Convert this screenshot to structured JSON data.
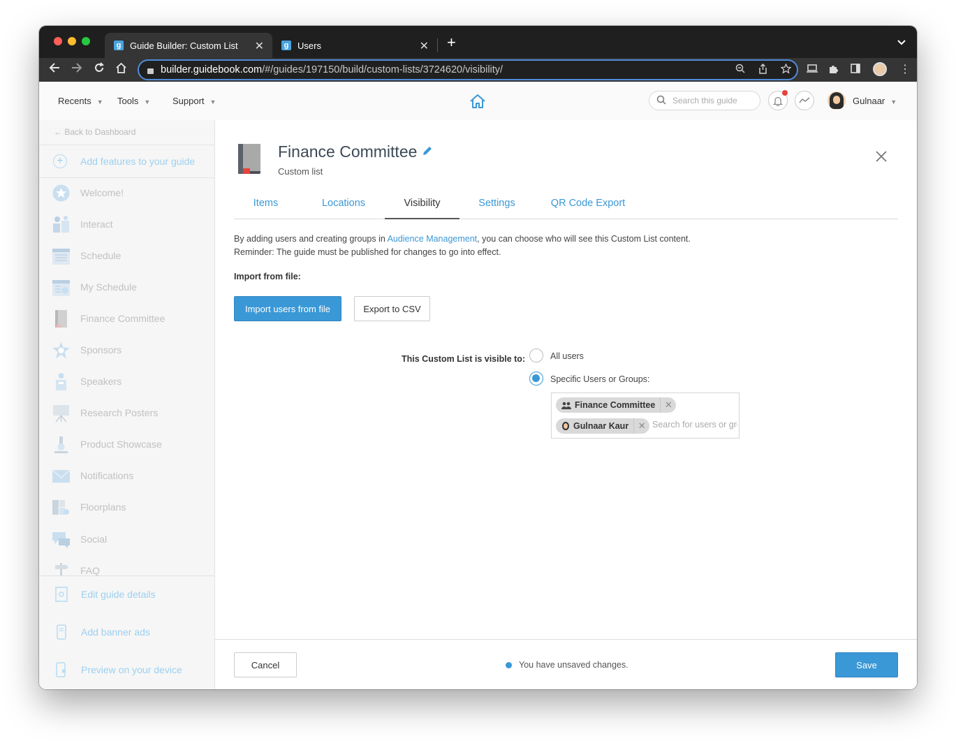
{
  "browser": {
    "tabs": [
      {
        "title": "Guide Builder: Custom List",
        "favicon": "g",
        "active": true
      },
      {
        "title": "Users",
        "favicon": "g",
        "active": false
      }
    ],
    "url_host": "builder.guidebook.com",
    "url_path": "/#/guides/197150/build/custom-lists/3724620/visibility/"
  },
  "header": {
    "menus": [
      "Recents",
      "Tools",
      "Support"
    ],
    "search_placeholder": "Search this guide",
    "user_name": "Gulnaar"
  },
  "sidebar": {
    "back_label": "← Back to Dashboard",
    "add_features_label": "Add features to your guide",
    "items": [
      {
        "label": "Welcome!",
        "icon": "star-badge-icon"
      },
      {
        "label": "Interact",
        "icon": "interact-icon"
      },
      {
        "label": "Schedule",
        "icon": "calendar-icon"
      },
      {
        "label": "My Schedule",
        "icon": "my-schedule-icon"
      },
      {
        "label": "Finance Committee",
        "icon": "book-icon"
      },
      {
        "label": "Sponsors",
        "icon": "sponsor-star-icon"
      },
      {
        "label": "Speakers",
        "icon": "podium-icon"
      },
      {
        "label": "Research Posters",
        "icon": "easel-icon"
      },
      {
        "label": "Product Showcase",
        "icon": "microscope-icon"
      },
      {
        "label": "Notifications",
        "icon": "envelope-icon"
      },
      {
        "label": "Floorplans",
        "icon": "floorplan-icon"
      },
      {
        "label": "Social",
        "icon": "chat-icon"
      },
      {
        "label": "FAQ",
        "icon": "signpost-icon"
      }
    ],
    "bottom_items": [
      {
        "label": "Edit guide details",
        "icon": "gear-doc-icon"
      },
      {
        "label": "Add banner ads",
        "icon": "phone-icon"
      },
      {
        "label": "Preview on your device",
        "icon": "preview-device-icon"
      }
    ]
  },
  "main": {
    "title": "Finance Committee",
    "subtitle": "Custom list",
    "tabs": [
      "Items",
      "Locations",
      "Visibility",
      "Settings",
      "QR Code Export"
    ],
    "active_tab": "Visibility",
    "description_pre": "By adding users and creating groups in ",
    "description_link": "Audience Management",
    "description_post": ", you can choose who will see this Custom List content.",
    "reminder": "Reminder: The guide must be published for changes to go into effect.",
    "import_label": "Import from file:",
    "import_button": "Import users from file",
    "export_button": "Export to CSV",
    "visible_to_label": "This Custom List is visible to:",
    "options": [
      {
        "label": "All users",
        "checked": false
      },
      {
        "label": "Specific Users or Groups:",
        "checked": true
      }
    ],
    "selected_tags": [
      {
        "label": "Finance Committee",
        "icon": "group-icon"
      },
      {
        "label": "Gulnaar Kaur",
        "icon": "user-avatar-icon"
      }
    ],
    "tag_search_placeholder": "Search for users or groups"
  },
  "footer": {
    "cancel_label": "Cancel",
    "status": "You have unsaved changes.",
    "save_label": "Save"
  },
  "colors": {
    "accent": "#3a98d6",
    "sidebar_bg": "#f6f6f6",
    "notification_dot": "#e8413b"
  }
}
